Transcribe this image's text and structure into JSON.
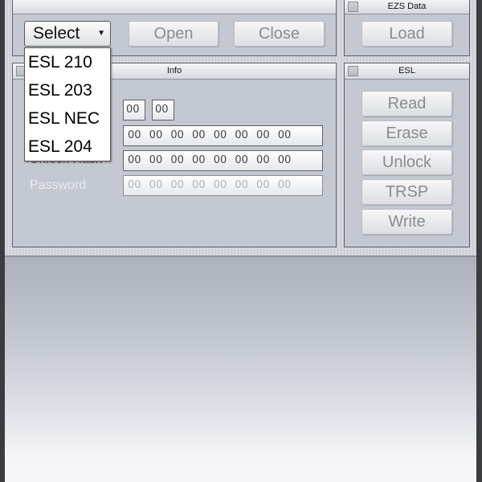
{
  "top_panel": {
    "combo": {
      "value": "Select",
      "options": [
        "ESL 210",
        "ESL 203",
        "ESL NEC",
        "ESL 204"
      ]
    },
    "open_label": "Open",
    "close_label": "Close"
  },
  "ezs_panel": {
    "title": "EZS Data",
    "load_label": "Load"
  },
  "info_panel": {
    "title": "Info",
    "small_fields": [
      "00",
      "00"
    ],
    "rows": [
      {
        "label": "",
        "value": "00 00 00 00 00 00 00 00"
      },
      {
        "label": "Unlock Hash",
        "value": "00 00 00 00 00 00 00 00"
      },
      {
        "label": "Password",
        "value": "00 00 00 00 00 00 00 00"
      }
    ]
  },
  "esl_panel": {
    "title": "ESL",
    "buttons": [
      "Read",
      "Erase",
      "Unlock",
      "TRSP",
      "Write"
    ]
  }
}
